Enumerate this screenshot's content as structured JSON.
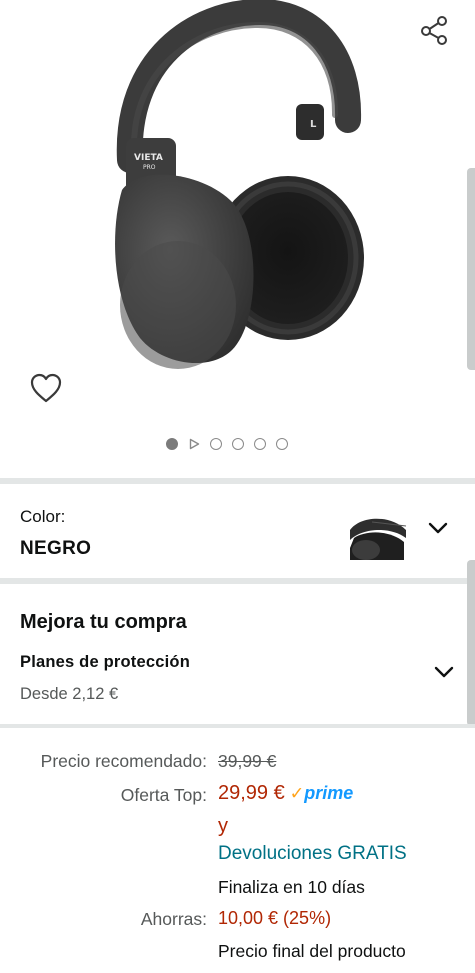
{
  "product": {
    "brand_logo": "VIETA PRO",
    "share_icon": "share-icon",
    "wishlist_icon": "heart-outline-icon",
    "carousel": {
      "count": 6,
      "active_index": 0,
      "video_index": 1
    }
  },
  "color": {
    "label": "Color:",
    "value": "NEGRO"
  },
  "upgrade": {
    "title": "Mejora tu compra",
    "plans_label": "Planes de protección",
    "plans_from": "Desde 2,12 €"
  },
  "pricing": {
    "list_label": "Precio recomendado:",
    "list_price": "39,99 €",
    "deal_label": "Oferta Top:",
    "deal_price": "29,99 €",
    "prime_check": "✓",
    "prime_label": "prime",
    "and_text": "y",
    "returns": "Devoluciones GRATIS",
    "ends_in": "Finaliza en 10 días",
    "savings_label": "Ahorras:",
    "savings_value": "10,00 € (25%)",
    "final_price_note": "Precio final del producto"
  },
  "colors": {
    "price_red": "#b12704",
    "link_teal": "#007185",
    "prime_blue": "#1399ff",
    "divider": "#e3e6e6"
  }
}
